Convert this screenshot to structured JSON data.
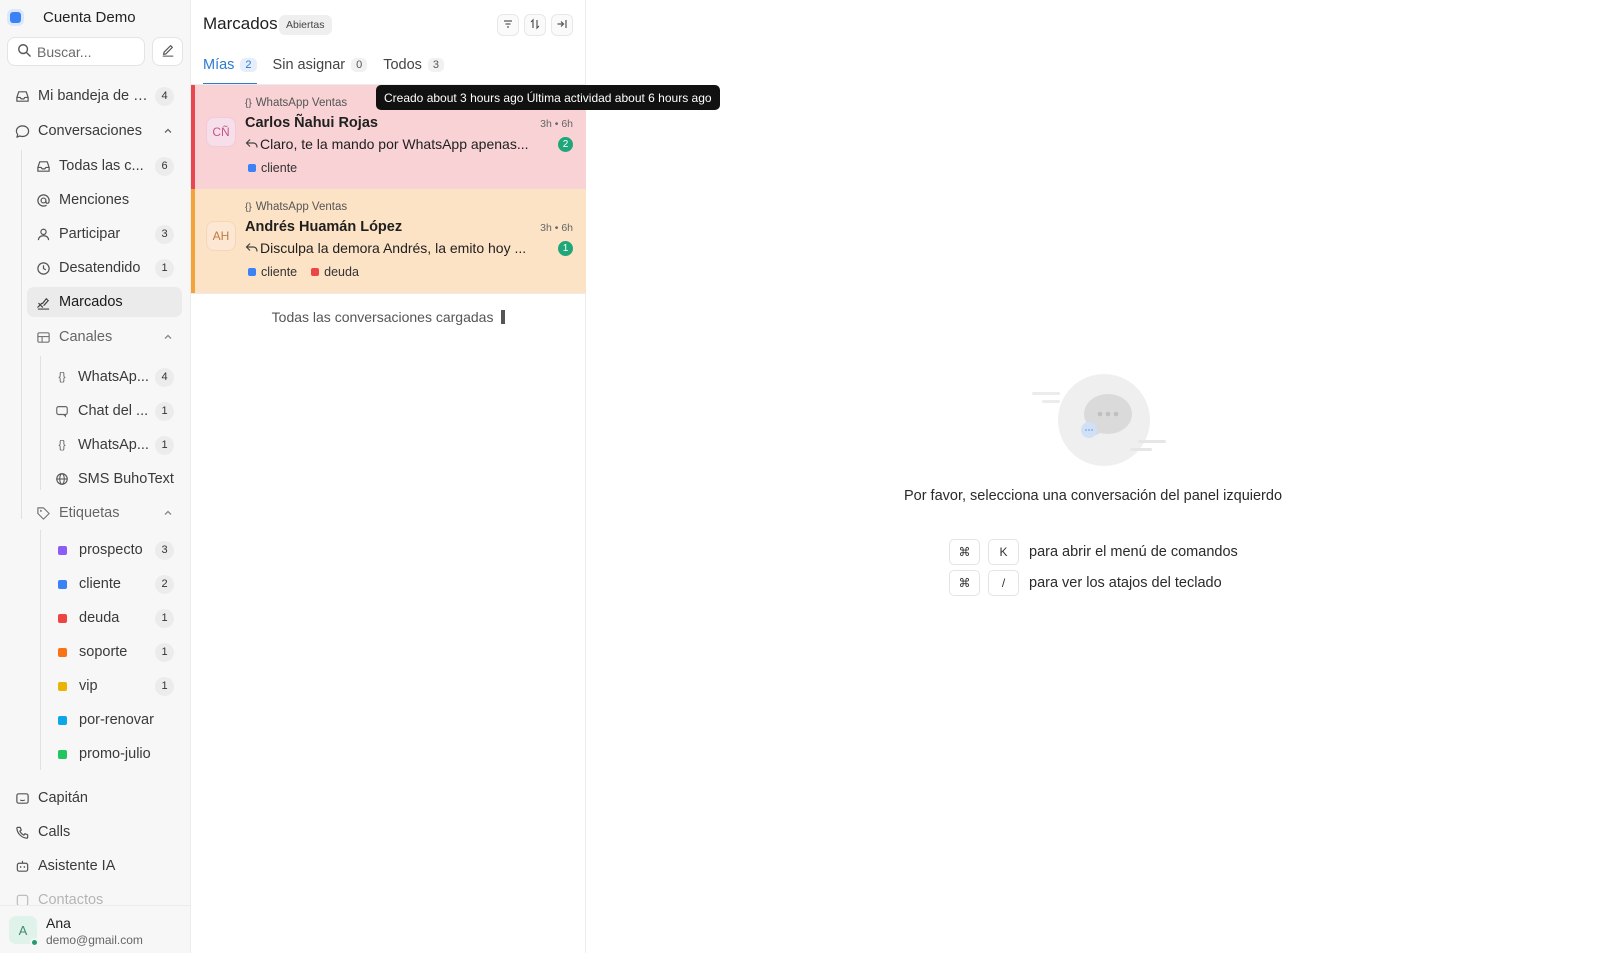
{
  "account": {
    "name": "Cuenta Demo"
  },
  "search": {
    "placeholder": "Buscar..."
  },
  "sidebar": {
    "inbox": {
      "label": "Mi bandeja de en...",
      "count": "4"
    },
    "conversations": {
      "label": "Conversaciones"
    },
    "conv_items": [
      {
        "label": "Todas las c...",
        "count": "6"
      },
      {
        "label": "Menciones",
        "count": ""
      },
      {
        "label": "Participar",
        "count": "3"
      },
      {
        "label": "Desatendido",
        "count": "1"
      },
      {
        "label": "Marcados",
        "count": ""
      }
    ],
    "channels": {
      "label": "Canales",
      "items": [
        {
          "label": "WhatsAp...",
          "count": "4",
          "icon": "braces-icon"
        },
        {
          "label": "Chat del ...",
          "count": "1",
          "icon": "chat-widget-icon"
        },
        {
          "label": "WhatsAp...",
          "count": "1",
          "icon": "braces-icon"
        },
        {
          "label": "SMS BuhoText",
          "count": "",
          "icon": "globe-icon"
        }
      ]
    },
    "tags": {
      "label": "Etiquetas",
      "items": [
        {
          "label": "prospecto",
          "count": "3",
          "color": "#8b5cf6"
        },
        {
          "label": "cliente",
          "count": "2",
          "color": "#3b82f6"
        },
        {
          "label": "deuda",
          "count": "1",
          "color": "#ef4444"
        },
        {
          "label": "soporte",
          "count": "1",
          "color": "#f97316"
        },
        {
          "label": "vip",
          "count": "1",
          "color": "#eab308"
        },
        {
          "label": "por-renovar",
          "count": "",
          "color": "#0ea5e9"
        },
        {
          "label": "promo-julio",
          "count": "",
          "color": "#22c55e"
        }
      ]
    },
    "bottom_items": [
      {
        "label": "Capitán"
      },
      {
        "label": "Calls"
      },
      {
        "label": "Asistente IA"
      },
      {
        "label": "Contactos"
      }
    ]
  },
  "user": {
    "initial": "A",
    "name": "Ana",
    "email": "demo@gmail.com"
  },
  "list": {
    "title": "Marcados",
    "status": "Abiertas",
    "tabs": [
      {
        "label": "Mías",
        "count": "2"
      },
      {
        "label": "Sin asignar",
        "count": "0"
      },
      {
        "label": "Todos",
        "count": "3"
      }
    ],
    "conversations": [
      {
        "initials": "CÑ",
        "inbox": "WhatsApp Ventas",
        "name": "Carlos Ñahui Rojas",
        "time": "3h • 6h",
        "message": "Claro, te la mando por WhatsApp apenas...",
        "unread": "2",
        "labels": [
          {
            "name": "cliente",
            "color": "#3b82f6"
          }
        ]
      },
      {
        "initials": "AH",
        "inbox": "WhatsApp Ventas",
        "name": "Andrés Huamán López",
        "time": "3h • 6h",
        "message": "Disculpa la demora Andrés, la emito hoy ...",
        "unread": "1",
        "labels": [
          {
            "name": "cliente",
            "color": "#3b82f6"
          },
          {
            "name": "deuda",
            "color": "#ef4444"
          }
        ]
      }
    ],
    "footer": "Todas las conversaciones cargadas"
  },
  "tooltip": "Creado about 3 hours ago Última actividad about 6 hours ago",
  "empty_state": {
    "title": "Por favor, selecciona una conversación del panel izquierdo",
    "shortcuts": [
      {
        "key1": "⌘",
        "key2": "K",
        "desc": "para abrir el menú de comandos"
      },
      {
        "key1": "⌘",
        "key2": "/",
        "desc": "para ver los atajos del teclado"
      }
    ]
  },
  "colors": {
    "accent": "#2b7bd1",
    "urgent_stripe": "#e8474d",
    "urgent_bg": "#f8d2d4",
    "warning_stripe": "#f2a33a",
    "warning_bg": "#fde3c6",
    "unread_badge": "#1fa77a"
  }
}
